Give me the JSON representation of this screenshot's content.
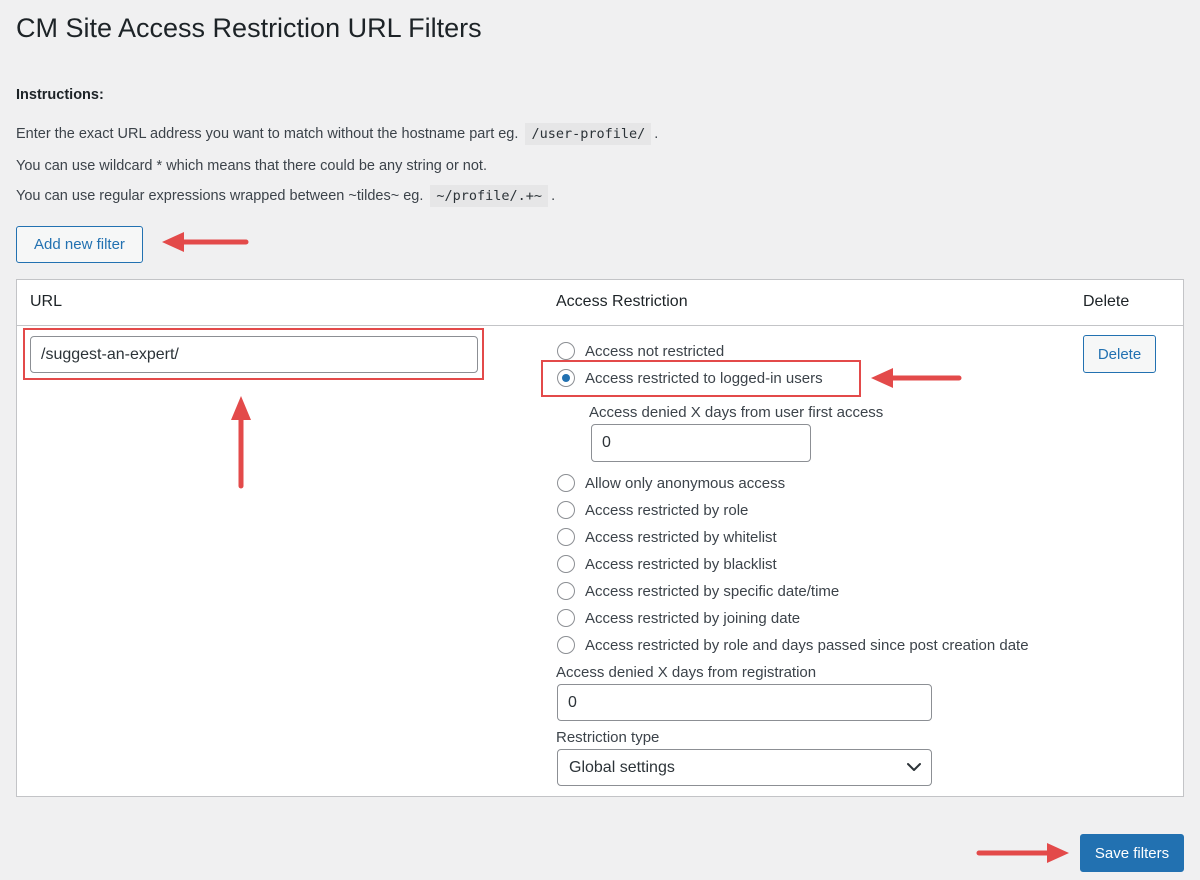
{
  "page": {
    "title": "CM Site Access Restriction URL Filters"
  },
  "instructions": {
    "heading": "Instructions:",
    "line1_text": "Enter the exact URL address you want to match without the hostname part eg.",
    "line1_code": "/user-profile/",
    "line1_end": ".",
    "line2_text": "You can use wildcard * which means that there could be any string or not.",
    "line3_text": "You can use regular expressions wrapped between ~tildes~ eg.",
    "line3_code": "~/profile/.+~",
    "line3_end": "."
  },
  "add_filter_label": "Add new filter",
  "table": {
    "headers": {
      "url": "URL",
      "access": "Access Restriction",
      "delete": "Delete"
    },
    "row": {
      "url_value": "/suggest-an-expert/",
      "delete_label": "Delete",
      "options": [
        {
          "label": "Access not restricted",
          "checked": false
        },
        {
          "label": "Access restricted to logged-in users",
          "checked": true
        },
        {
          "label": "Allow only anonymous access",
          "checked": false
        },
        {
          "label": "Access restricted by role",
          "checked": false
        },
        {
          "label": "Access restricted by whitelist",
          "checked": false
        },
        {
          "label": "Access restricted by blacklist",
          "checked": false
        },
        {
          "label": "Access restricted by specific date/time",
          "checked": false
        },
        {
          "label": "Access restricted by joining date",
          "checked": false
        },
        {
          "label": "Access restricted by role and days passed since post creation date",
          "checked": false
        }
      ],
      "first_access": {
        "label": "Access denied X days from user first access",
        "value": "0"
      },
      "registration": {
        "label": "Access denied X days from registration",
        "value": "0"
      },
      "restriction_type": {
        "label": "Restriction type",
        "value": "Global settings"
      }
    }
  },
  "save_label": "Save filters",
  "colors": {
    "accent": "#2271b1",
    "annotation_red": "#e34a4a",
    "background": "#f0f0f1",
    "border": "#c3c4c7"
  }
}
